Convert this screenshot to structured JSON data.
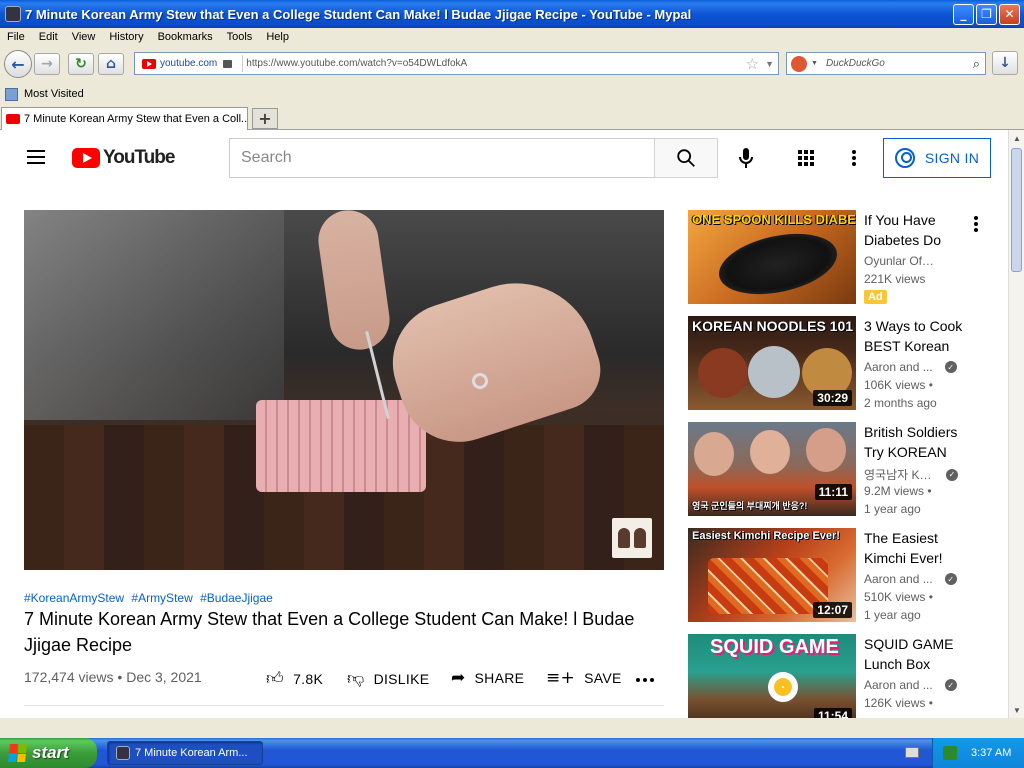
{
  "window": {
    "title": "7 Minute Korean Army Stew that Even a College Student Can Make! l Budae Jjigae Recipe - YouTube - Mypal",
    "minimize": "_",
    "maximize": "❐",
    "close": "✕"
  },
  "menu": [
    "File",
    "Edit",
    "View",
    "History",
    "Bookmarks",
    "Tools",
    "Help"
  ],
  "nav": {
    "back": "←",
    "forward": "→",
    "reload": "↻",
    "home": "⌂",
    "site_chip": "youtube.com",
    "url": "https://www.youtube.com/watch?v=o54DWLdfokA",
    "search_engine_placeholder": "DuckDuckGo",
    "download": "↓"
  },
  "bookmarks": {
    "most_visited": "Most Visited"
  },
  "tabs": {
    "active_label": "7 Minute Korean Army Stew that Even a Coll...",
    "add": "+"
  },
  "youtube": {
    "logo_text": "YouTube",
    "search_placeholder": "Search",
    "sign_in": "SIGN IN",
    "brand_red": "#FF0000",
    "link_blue": "#065FD4"
  },
  "video": {
    "hashtags": [
      "#KoreanArmyStew",
      "#ArmyStew",
      "#BudaeJjigae"
    ],
    "title": "7 Minute Korean Army Stew that Even a College Student Can Make! l Budae Jjigae Recipe",
    "views": "172,474 views",
    "separator": "•",
    "date": "Dec 3, 2021",
    "likes": "7.8K",
    "dislike": "DISLIKE",
    "share": "SHARE",
    "save": "SAVE"
  },
  "recommendations": [
    {
      "thumb_caption": "ONE SPOON KILLS DIABETES",
      "title": "If You Have Diabetes Do",
      "channel": "Oyunlar Official",
      "views": "221K views",
      "age": "",
      "badge": "Ad",
      "duration": "",
      "verified": false
    },
    {
      "thumb_caption": "KOREAN NOODLES 101",
      "title": "3 Ways to Cook BEST Korean",
      "channel": "Aaron and ...",
      "views": "106K views",
      "age": "2 months ago",
      "badge": "",
      "duration": "30:29",
      "verified": true
    },
    {
      "thumb_caption": "영국 군인들의 부대찌개 반응?!",
      "title": "British Soldiers Try KOREAN",
      "channel": "영국남자 Ko...",
      "views": "9.2M views",
      "age": "1 year ago",
      "badge": "",
      "duration": "11:11",
      "verified": true
    },
    {
      "thumb_caption": "Easiest Kimchi Recipe Ever!",
      "title": "The Easiest Kimchi Ever!",
      "channel": "Aaron and ...",
      "views": "510K views",
      "age": "1 year ago",
      "badge": "",
      "duration": "12:07",
      "verified": true
    },
    {
      "thumb_caption": "SQUID GAME",
      "title": "SQUID GAME Lunch Box",
      "channel": "Aaron and ...",
      "views": "126K views",
      "age": "",
      "badge": "",
      "duration": "11:54",
      "verified": true
    }
  ],
  "taskbar": {
    "start": "start",
    "task_label": "7 Minute Korean Arm...",
    "clock": "3:37 AM"
  }
}
